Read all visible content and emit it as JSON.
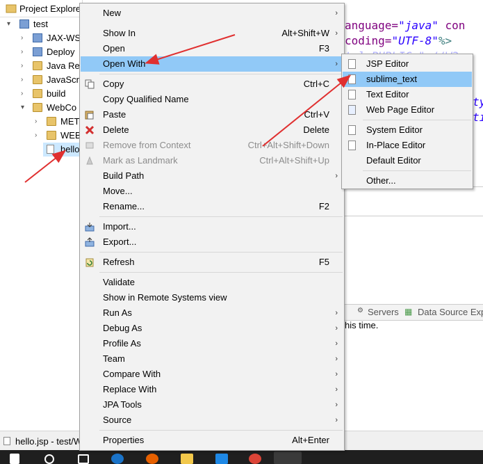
{
  "explorer": {
    "tab_title": "Project Explore",
    "tree": [
      {
        "label": "test",
        "twisty": "▾",
        "icon": "project"
      },
      {
        "label": "JAX-WS",
        "twisty": "›",
        "icon": "ws"
      },
      {
        "label": "Deploy",
        "twisty": "›",
        "icon": "deploy"
      },
      {
        "label": "Java Re",
        "twisty": "›",
        "icon": "library"
      },
      {
        "label": "JavaScri",
        "twisty": "›",
        "icon": "library"
      },
      {
        "label": "build",
        "twisty": "›",
        "icon": "folder"
      },
      {
        "label": "WebCo",
        "twisty": "▾",
        "icon": "folder-open"
      },
      {
        "label": "MET",
        "twisty": "›",
        "icon": "folder"
      },
      {
        "label": "WEB",
        "twisty": "›",
        "icon": "folder"
      },
      {
        "label": "hello",
        "twisty": "",
        "icon": "file"
      }
    ]
  },
  "editor": {
    "line1": {
      "attr": "anguage=",
      "val": "\"java\"",
      "rest": " con"
    },
    "line2": {
      "attr": "coding=",
      "val": "\"UTF-8\"",
      "end": "%>"
    },
    "line3": "tml PUBLIC \"-//W3",
    "line4": "ty",
    "line5": "ti"
  },
  "bottom_panel": {
    "tab_servers": "Servers",
    "tab_datasource": "Data Source Exp",
    "message": "his time."
  },
  "status": {
    "text": "hello.jsp - test/W"
  },
  "context_menu": {
    "items": [
      {
        "label": "New",
        "shortcut": "",
        "arrow": true,
        "icon": ""
      },
      {
        "label": "Show In",
        "shortcut": "Alt+Shift+W",
        "arrow": true,
        "icon": ""
      },
      {
        "label": "Open",
        "shortcut": "F3",
        "arrow": false,
        "icon": ""
      },
      {
        "label": "Open With",
        "shortcut": "",
        "arrow": true,
        "icon": ""
      },
      {
        "label": "Copy",
        "shortcut": "Ctrl+C",
        "arrow": false,
        "icon": "copy"
      },
      {
        "label": "Copy Qualified Name",
        "shortcut": "",
        "arrow": false,
        "icon": ""
      },
      {
        "label": "Paste",
        "shortcut": "Ctrl+V",
        "arrow": false,
        "icon": "paste"
      },
      {
        "label": "Delete",
        "shortcut": "Delete",
        "arrow": false,
        "icon": "delete"
      },
      {
        "label": "Remove from Context",
        "shortcut": "Ctrl+Alt+Shift+Down",
        "arrow": false,
        "icon": "remove",
        "disabled": true
      },
      {
        "label": "Mark as Landmark",
        "shortcut": "Ctrl+Alt+Shift+Up",
        "arrow": false,
        "icon": "landmark",
        "disabled": true
      },
      {
        "label": "Build Path",
        "shortcut": "",
        "arrow": true,
        "icon": ""
      },
      {
        "label": "Move...",
        "shortcut": "",
        "arrow": false,
        "icon": ""
      },
      {
        "label": "Rename...",
        "shortcut": "F2",
        "arrow": false,
        "icon": ""
      },
      {
        "label": "Import...",
        "shortcut": "",
        "arrow": false,
        "icon": "import"
      },
      {
        "label": "Export...",
        "shortcut": "",
        "arrow": false,
        "icon": "export"
      },
      {
        "label": "Refresh",
        "shortcut": "F5",
        "arrow": false,
        "icon": "refresh"
      },
      {
        "label": "Validate",
        "shortcut": "",
        "arrow": false,
        "icon": ""
      },
      {
        "label": "Show in Remote Systems view",
        "shortcut": "",
        "arrow": false,
        "icon": ""
      },
      {
        "label": "Run As",
        "shortcut": "",
        "arrow": true,
        "icon": ""
      },
      {
        "label": "Debug As",
        "shortcut": "",
        "arrow": true,
        "icon": ""
      },
      {
        "label": "Profile As",
        "shortcut": "",
        "arrow": true,
        "icon": ""
      },
      {
        "label": "Team",
        "shortcut": "",
        "arrow": true,
        "icon": ""
      },
      {
        "label": "Compare With",
        "shortcut": "",
        "arrow": true,
        "icon": ""
      },
      {
        "label": "Replace With",
        "shortcut": "",
        "arrow": true,
        "icon": ""
      },
      {
        "label": "JPA Tools",
        "shortcut": "",
        "arrow": true,
        "icon": ""
      },
      {
        "label": "Source",
        "shortcut": "",
        "arrow": true,
        "icon": ""
      },
      {
        "label": "Properties",
        "shortcut": "Alt+Enter",
        "arrow": false,
        "icon": ""
      }
    ],
    "highlighted": "Open With"
  },
  "open_with_submenu": {
    "items": [
      {
        "label": "JSP Editor",
        "icon": "file"
      },
      {
        "label": "sublime_text",
        "icon": "file"
      },
      {
        "label": "Text Editor",
        "icon": "file"
      },
      {
        "label": "Web Page Editor",
        "icon": "webpage"
      },
      {
        "label": "System Editor",
        "icon": "file"
      },
      {
        "label": "In-Place Editor",
        "icon": "inplace"
      },
      {
        "label": "Default Editor",
        "icon": ""
      },
      {
        "label": "Other...",
        "icon": ""
      }
    ],
    "highlighted": "sublime_text"
  },
  "colors": {
    "highlight": "#91c9f7",
    "annotation_arrow": "#e03030",
    "menu_bg": "#f2f2f2"
  },
  "taskbar": {
    "icons": [
      "windows-start-icon",
      "search-icon",
      "task-view-icon",
      "edge-icon",
      "firefox-icon",
      "file-explorer-icon",
      "app-icon",
      "chrome-icon",
      "eclipse-icon"
    ]
  }
}
